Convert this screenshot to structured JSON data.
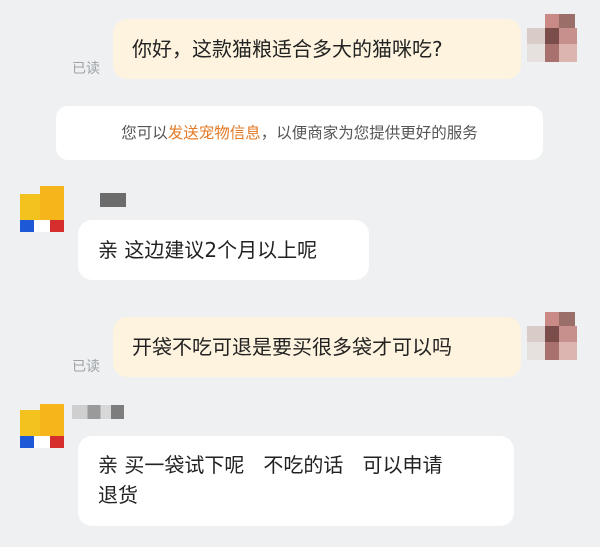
{
  "messages": [
    {
      "sender": "user",
      "text": "你好，这款猫粮适合多大的猫咪吃?",
      "status": "已读"
    },
    {
      "sender": "merchant",
      "text": "亲 这边建议2个月以上呢"
    },
    {
      "sender": "user",
      "text": "开袋不吃可退是要买很多袋才可以吗",
      "status": "已读"
    },
    {
      "sender": "merchant",
      "text_line1": "亲 买一袋试下呢   不吃的话   可以申请",
      "text_line2": "退货"
    }
  ],
  "notice": {
    "prefix": "您可以",
    "link": "发送宠物信息",
    "suffix": "，以便商家为您提供更好的服务"
  },
  "colors": {
    "user_bubble": "#fdf3df",
    "merchant_bubble": "#ffffff",
    "background": "#eef0f1",
    "link": "#e47a26",
    "read_label": "#9ea3a8"
  },
  "icons": {
    "user_avatar": "pixelated-avatar",
    "merchant_avatar": "pixelated-shop-logo"
  }
}
